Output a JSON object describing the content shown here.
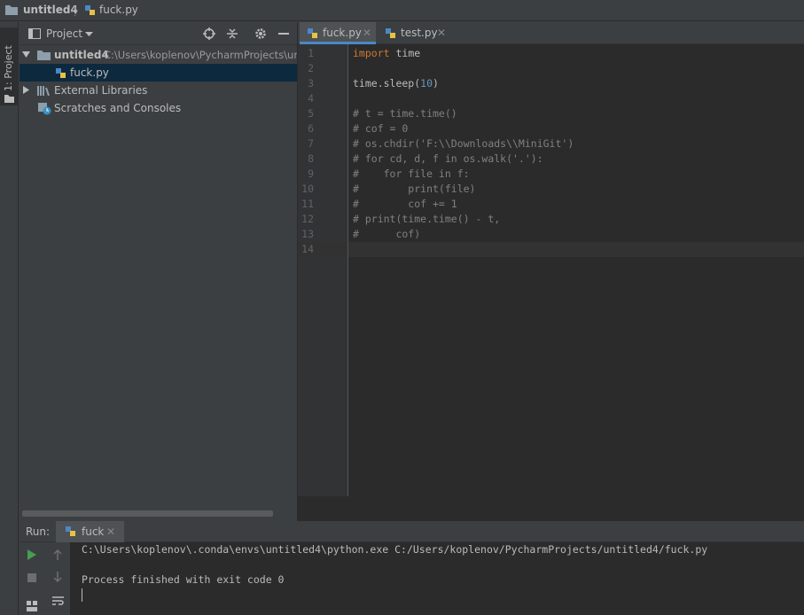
{
  "breadcrumb": {
    "project": "untitled4",
    "file": "fuck.py"
  },
  "stripe": {
    "project_tab": "1: Project"
  },
  "project_panel": {
    "title": "Project",
    "tree": [
      {
        "label": "untitled4",
        "path": "C:\\Users\\koplenov\\PycharmProjects\\untitl"
      },
      {
        "label": "fuck.py"
      },
      {
        "label": "External Libraries"
      },
      {
        "label": "Scratches and Consoles"
      }
    ]
  },
  "editor": {
    "tabs": [
      {
        "label": "fuck.py",
        "active": true
      },
      {
        "label": "test.py",
        "active": false
      }
    ],
    "lines": [
      {
        "n": "1",
        "parts": [
          {
            "t": "import",
            "c": "kw"
          },
          {
            "t": " time",
            "c": ""
          }
        ]
      },
      {
        "n": "2",
        "parts": []
      },
      {
        "n": "3",
        "parts": [
          {
            "t": "time.sleep(",
            "c": ""
          },
          {
            "t": "10",
            "c": "num"
          },
          {
            "t": ")",
            "c": ""
          }
        ]
      },
      {
        "n": "4",
        "parts": []
      },
      {
        "n": "5",
        "parts": [
          {
            "t": "# t = time.time()",
            "c": "cm"
          }
        ]
      },
      {
        "n": "6",
        "parts": [
          {
            "t": "# cof = 0",
            "c": "cm"
          }
        ]
      },
      {
        "n": "7",
        "parts": [
          {
            "t": "# os.chdir('F:\\\\Downloads\\\\MiniGit')",
            "c": "cm"
          }
        ]
      },
      {
        "n": "8",
        "parts": [
          {
            "t": "# for cd, d, f in os.walk('.'):",
            "c": "cm"
          }
        ]
      },
      {
        "n": "9",
        "parts": [
          {
            "t": "#    for file in f:",
            "c": "cm"
          }
        ]
      },
      {
        "n": "10",
        "parts": [
          {
            "t": "#        print(file)",
            "c": "cm"
          }
        ]
      },
      {
        "n": "11",
        "parts": [
          {
            "t": "#        cof += 1",
            "c": "cm"
          }
        ]
      },
      {
        "n": "12",
        "parts": [
          {
            "t": "# print(time.time() - t,",
            "c": "cm"
          }
        ]
      },
      {
        "n": "13",
        "parts": [
          {
            "t": "#      cof)",
            "c": "cm"
          }
        ]
      },
      {
        "n": "14",
        "parts": []
      }
    ],
    "current_line": "14"
  },
  "run_panel": {
    "label": "Run:",
    "tab": "fuck",
    "output": [
      "C:\\Users\\koplenov\\.conda\\envs\\untitled4\\python.exe C:/Users/koplenov/PycharmProjects/untitled4/fuck.py",
      "",
      "Process finished with exit code 0"
    ]
  },
  "colors": {
    "keyword": "#cc7832",
    "number": "#6897bb",
    "comment": "#808080",
    "selection": "#0d293e",
    "accent": "#4a88c7",
    "run_green": "#499c54"
  }
}
